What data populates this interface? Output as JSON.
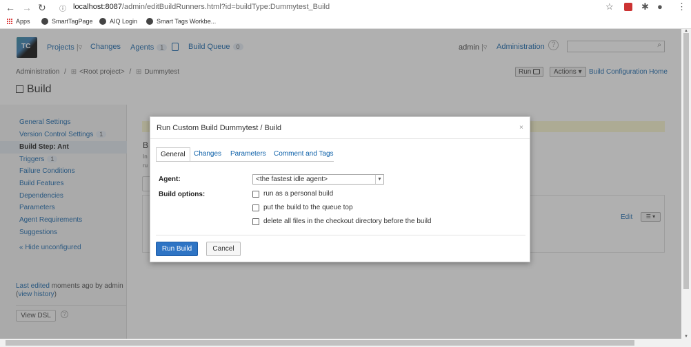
{
  "browser": {
    "url_host": "localhost:8087",
    "url_path": "/admin/editBuildRunners.html?id=buildType:Dummytest_Build",
    "bookmarks": [
      {
        "label": "Apps"
      },
      {
        "label": "SmartTagPage"
      },
      {
        "label": "AIQ Login"
      },
      {
        "label": "Smart Tags Workbe..."
      }
    ]
  },
  "header": {
    "logo_text": "TC",
    "nav": {
      "projects": "Projects",
      "changes": "Changes",
      "agents": "Agents",
      "agents_count": "1",
      "build_queue": "Build Queue",
      "build_queue_count": "0"
    },
    "user": "admin",
    "administration": "Administration",
    "help": "?"
  },
  "breadcrumb": {
    "items": [
      "Administration",
      "/",
      "<Root project>",
      "/",
      "Dummytest"
    ]
  },
  "toolbar": {
    "run_label": "Run",
    "actions_label": "Actions",
    "home_link": "Build Configuration Home"
  },
  "page_title": "Build",
  "sidebar": {
    "items": [
      {
        "label": "General Settings",
        "badge": ""
      },
      {
        "label": "Version Control Settings",
        "badge": "1"
      },
      {
        "label": "Build Step: Ant",
        "badge": ""
      },
      {
        "label": "Triggers",
        "badge": "1"
      },
      {
        "label": "Failure Conditions",
        "badge": ""
      },
      {
        "label": "Build Features",
        "badge": ""
      },
      {
        "label": "Dependencies",
        "badge": ""
      },
      {
        "label": "Parameters",
        "badge": ""
      },
      {
        "label": "Agent Requirements",
        "badge": ""
      },
      {
        "label": "Suggestions",
        "badge": ""
      },
      {
        "label": "« Hide unconfigured",
        "badge": ""
      }
    ],
    "last_edited_prefix": "Last edited",
    "last_edited_when": "moments ago",
    "last_edited_by": "by admin",
    "view_history": "view history",
    "view_dsl": "View DSL"
  },
  "content": {
    "heading_fragment": "B",
    "line1_fragment": "In",
    "line2_fragment": "ru",
    "edit_link": "Edit"
  },
  "modal": {
    "title": "Run Custom Build Dummytest / Build",
    "close": "×",
    "tabs": [
      "General",
      "Changes",
      "Parameters",
      "Comment and Tags"
    ],
    "agent_label": "Agent:",
    "agent_value": "<the fastest idle agent>",
    "options_label": "Build options:",
    "options": [
      {
        "label": "run as a personal build",
        "checked": false
      },
      {
        "label": "put the build to the queue top",
        "checked": false
      },
      {
        "label": "delete all files in the checkout directory before the build",
        "checked": false
      }
    ],
    "run_button": "Run Build",
    "cancel_button": "Cancel"
  }
}
